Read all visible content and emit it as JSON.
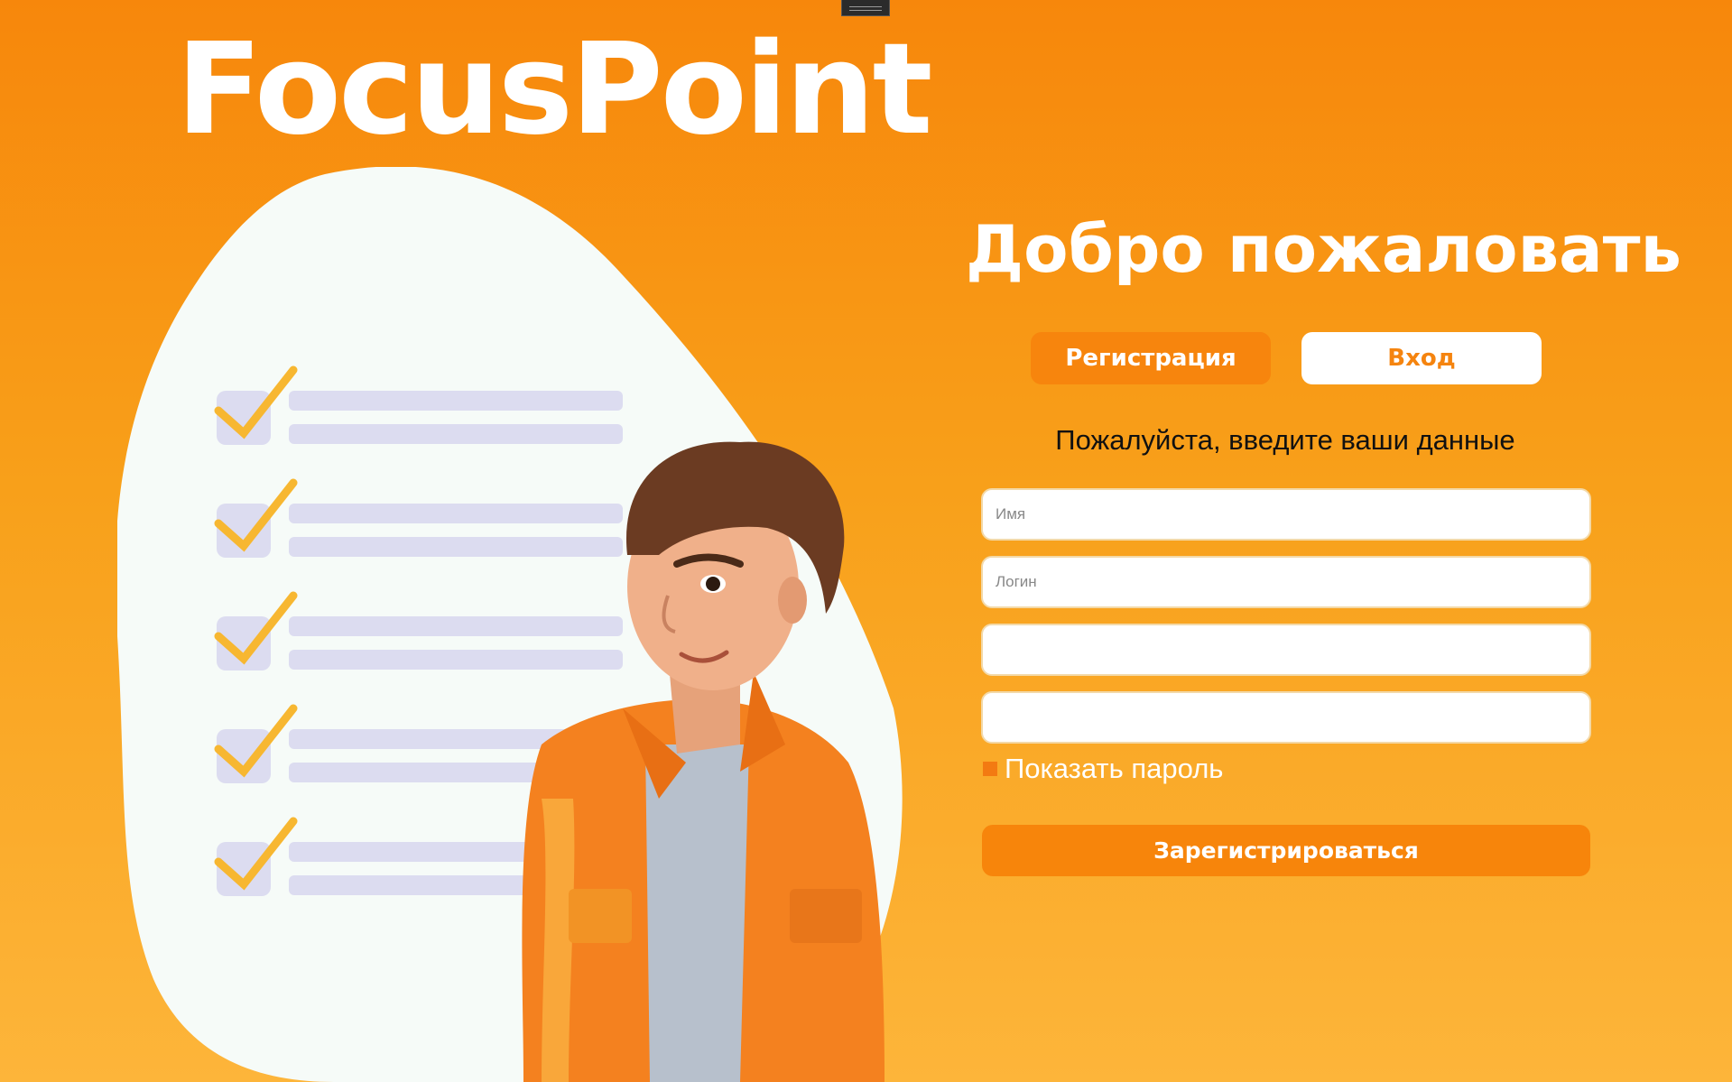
{
  "brand": {
    "title": "FocusPoint"
  },
  "form": {
    "heading": "Добро пожаловать",
    "tabs": [
      {
        "label": "Регистрация",
        "active": true
      },
      {
        "label": "Вход",
        "active": false
      }
    ],
    "subtitle": "Пожалуйста, введите ваши данные",
    "fields": [
      {
        "placeholder": "Имя",
        "value": ""
      },
      {
        "placeholder": "Логин",
        "value": ""
      },
      {
        "placeholder": "",
        "value": ""
      },
      {
        "placeholder": "",
        "value": ""
      }
    ],
    "show_password_label": "Показать пароль",
    "submit_label": "Зарегистрироваться"
  },
  "illustration": {
    "description_icons": [
      "checklist-icon",
      "person-illustration"
    ],
    "checklist_count": 5
  },
  "colors": {
    "accent": "#f7850b",
    "check": "#f7b731",
    "line": "#dcdcf0",
    "blob": "#f6fbf8"
  }
}
